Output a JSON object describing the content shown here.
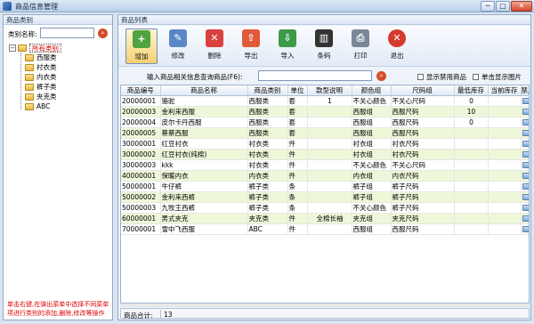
{
  "window": {
    "title": "商品信息管理",
    "buttons": {
      "minimize": "─",
      "maximize": "□",
      "close": "✕"
    }
  },
  "left_panel": {
    "title": "商品类别",
    "category_label": "类别名称:",
    "category_value": "",
    "tree": {
      "root": "所有类别",
      "children": [
        "西服类",
        "衬衣类",
        "内衣类",
        "裤子类",
        "夹克类",
        "ABC"
      ]
    },
    "hint": "单击右键,在弹出菜单中选择不同菜单项进行类别的添加,删除,修改等操作"
  },
  "right_panel": {
    "title": "商品列表",
    "toolbar": [
      {
        "id": "add",
        "label": "增加",
        "icon": "add-icon",
        "color": "#4fa43f",
        "glyph": "+"
      },
      {
        "id": "edit",
        "label": "修改",
        "icon": "edit-icon",
        "color": "#5a86c8",
        "glyph": "✎"
      },
      {
        "id": "delete",
        "label": "删除",
        "icon": "delete-icon",
        "color": "#d94040",
        "glyph": "✕"
      },
      {
        "id": "export",
        "label": "导出",
        "icon": "export-icon",
        "color": "#e05a3a",
        "glyph": "⇧"
      },
      {
        "id": "import",
        "label": "导入",
        "icon": "import-icon",
        "color": "#3c9a4a",
        "glyph": "⇩"
      },
      {
        "id": "barcode",
        "label": "条码",
        "icon": "barcode-icon",
        "color": "#333333",
        "glyph": "▥"
      },
      {
        "id": "print",
        "label": "打印",
        "icon": "print-icon",
        "color": "#7b8796",
        "glyph": "⎙"
      },
      {
        "id": "exit",
        "label": "退出",
        "icon": "exit-icon",
        "color": "#d33a2c",
        "glyph": "✕"
      }
    ],
    "query_label": "输入商品相关信息查询商品(F6):",
    "query_value": "",
    "show_disabled_label": "显示禁用商品",
    "show_single_image_label": "单击显示图片",
    "columns": [
      "商品编号",
      "商品名称",
      "商品类别",
      "单位",
      "款型说明",
      "颜色组",
      "尺码组",
      "最低库存",
      "当前库存",
      "禁用"
    ],
    "rows": [
      [
        "20000001",
        "骆驼",
        "西服类",
        "套",
        "1",
        "不关心颜色",
        "不关心尺码",
        "0",
        "",
        ""
      ],
      [
        "20000003",
        "金利来西服",
        "西服类",
        "套",
        "",
        "西服组",
        "西服尺码",
        "10",
        "",
        ""
      ],
      [
        "20000004",
        "皮尔卡丹西服",
        "西服类",
        "套",
        "",
        "西服组",
        "西服尺码",
        "0",
        "",
        ""
      ],
      [
        "20000005",
        "蔡蔡西服",
        "西服类",
        "套",
        "",
        "西服组",
        "西服尺码",
        "",
        "",
        ""
      ],
      [
        "30000001",
        "红豆衬衣",
        "衬衣类",
        "件",
        "",
        "衬衣组",
        "衬衣尺码",
        "",
        "",
        ""
      ],
      [
        "30000002",
        "红豆衬衣(纯棉)",
        "衬衣类",
        "件",
        "",
        "衬衣组",
        "衬衣尺码",
        "",
        "",
        ""
      ],
      [
        "30000003",
        "kkk",
        "衬衣类",
        "件",
        "",
        "不关心颜色",
        "不关心尺码",
        "",
        "",
        ""
      ],
      [
        "40000001",
        "保暖内衣",
        "内衣类",
        "件",
        "",
        "内衣组",
        "内衣尺码",
        "",
        "",
        ""
      ],
      [
        "50000001",
        "牛仔裤",
        "裤子类",
        "条",
        "",
        "裤子组",
        "裤子尺码",
        "",
        "",
        ""
      ],
      [
        "50000002",
        "金利来西裤",
        "裤子类",
        "条",
        "",
        "裤子组",
        "裤子尺码",
        "",
        "",
        ""
      ],
      [
        "50000003",
        "九牧王西裤",
        "裤子类",
        "条",
        "",
        "不关心颜色",
        "裤子尺码",
        "",
        "",
        ""
      ],
      [
        "60000001",
        "男式夹克",
        "夹克类",
        "件",
        "全棉长袖",
        "夹克组",
        "夹克尺码",
        "",
        "",
        ""
      ],
      [
        "70000001",
        "雪中飞西服",
        "ABC",
        "件",
        "",
        "西服组",
        "西服尺码",
        "",
        "",
        ""
      ]
    ],
    "footer_label": "商品合计:",
    "footer_count": "13"
  }
}
